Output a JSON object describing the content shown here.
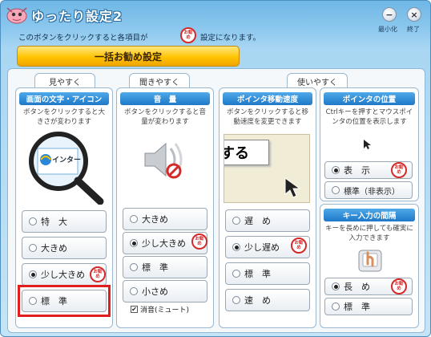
{
  "app": {
    "title": "ゆったり設定2",
    "minimize_label": "最小化",
    "exit_label": "終了"
  },
  "hint": {
    "before": "このボタンをクリックすると各項目が",
    "after": "設定になります。"
  },
  "stamp": {
    "text": "お勧め"
  },
  "recommend_button": "一括お勧め設定",
  "categories": {
    "see": "見やすく",
    "hear": "聞きやすく",
    "use": "使いやすく"
  },
  "text_icon": {
    "heading": "画面の文字・アイコン",
    "desc": "ボタンをクリックすると大きさが変わります",
    "sample_text": "インター",
    "options": [
      "特　大",
      "大きめ",
      "少し大きめ",
      "標　準"
    ],
    "selected": "少し大きめ"
  },
  "volume": {
    "heading": "音　量",
    "desc": "ボタンをクリックすると音量が変わります",
    "options": [
      "大きめ",
      "少し大きめ",
      "標　準",
      "小さめ"
    ],
    "selected": "少し大きめ",
    "mute_label": "消音(ミュート)",
    "mute_checked": true
  },
  "pointer_speed": {
    "heading": "ポインタ移動速度",
    "desc": "ボタンをクリックすると移動速度を変更できます",
    "sample_text": "する",
    "options": [
      "遅　め",
      "少し遅め",
      "標　準",
      "速　め"
    ],
    "selected": "少し遅め"
  },
  "pointer_position": {
    "heading": "ポインタの位置",
    "desc": "Ctrlキーを押すとマウスポインタの位置を表示します",
    "options": [
      "表　示",
      "標準（非表示）"
    ],
    "selected": "表　示"
  },
  "key_interval": {
    "heading": "キー入力の間隔",
    "desc": "キーを長めに押しても確実に入力できます",
    "options": [
      "長　め",
      "標　準"
    ],
    "selected": "長　め"
  },
  "colors": {
    "accent": "#1e78c8",
    "recommend": "#ffc300",
    "highlight": "#e01e1e"
  }
}
